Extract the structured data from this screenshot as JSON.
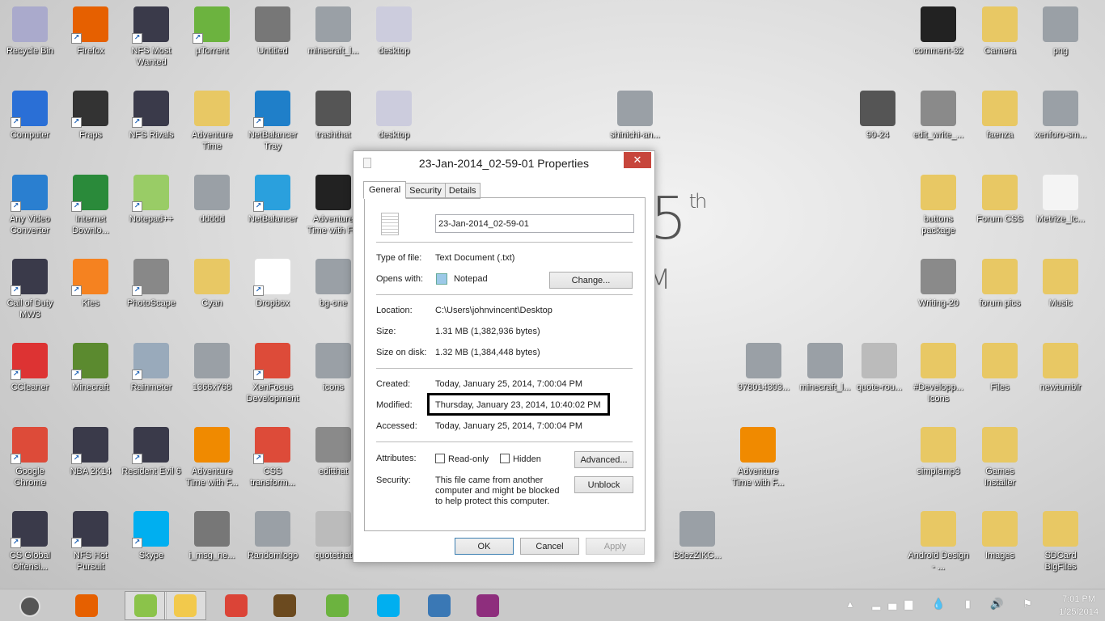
{
  "wallpaper": {
    "clock_day": "25",
    "clock_suffix": "th",
    "clock_fragment": "M"
  },
  "desktop_icons": [
    {
      "label": "Recycle Bin",
      "icon": "recycle-bin-icon",
      "short": false
    },
    {
      "label": "Firefox",
      "icon": "firefox-icon",
      "short": true
    },
    {
      "label": "NFS Most Wanted",
      "icon": "game-icon",
      "short": true
    },
    {
      "label": "µTorrent",
      "icon": "utorrent-icon",
      "short": true
    },
    {
      "label": "Untitled",
      "icon": "gimp-icon",
      "short": false
    },
    {
      "label": "minecraft_l...",
      "icon": "image-icon",
      "short": false
    },
    {
      "label": "desktop",
      "icon": "settings-file-icon",
      "short": false
    },
    {
      "label": "Computer",
      "icon": "computer-icon",
      "short": true
    },
    {
      "label": "Fraps",
      "icon": "fraps-icon",
      "short": true
    },
    {
      "label": "NFS Rivals",
      "icon": "game-icon",
      "short": true
    },
    {
      "label": "Adventure Time",
      "icon": "folder-icon",
      "short": false
    },
    {
      "label": "NetBalancer Tray",
      "icon": "netbalancer-icon",
      "short": true
    },
    {
      "label": "trashthat",
      "icon": "trash-icon",
      "short": false
    },
    {
      "label": "desktop",
      "icon": "settings-file-icon",
      "short": false
    },
    {
      "label": "Any Video Converter",
      "icon": "video-converter-icon",
      "short": true
    },
    {
      "label": "Internet Downlo...",
      "icon": "download-manager-icon",
      "short": true
    },
    {
      "label": "Notepad++",
      "icon": "notepadpp-icon",
      "short": true
    },
    {
      "label": "ddddd",
      "icon": "image-icon",
      "short": false
    },
    {
      "label": "NetBalancer",
      "icon": "globe-icon",
      "short": true
    },
    {
      "label": "Adventure Time with F...",
      "icon": "video-icon",
      "short": false
    },
    {
      "label": "Call of Duty MW3",
      "icon": "game-icon",
      "short": true
    },
    {
      "label": "Kies",
      "icon": "kies-icon",
      "short": true
    },
    {
      "label": "PhotoScape",
      "icon": "photoscape-icon",
      "short": true
    },
    {
      "label": "Cyan",
      "icon": "folder-icon",
      "short": false
    },
    {
      "label": "Dropbox",
      "icon": "dropbox-icon",
      "short": true
    },
    {
      "label": "bg-one",
      "icon": "image-icon",
      "short": false
    },
    {
      "label": "CCleaner",
      "icon": "ccleaner-icon",
      "short": true
    },
    {
      "label": "Minecraft",
      "icon": "minecraft-icon",
      "short": true
    },
    {
      "label": "Rainmeter",
      "icon": "rainmeter-icon",
      "short": true
    },
    {
      "label": "1366x768",
      "icon": "image-icon",
      "short": false
    },
    {
      "label": "XenFocus Development",
      "icon": "chrome-icon",
      "short": true
    },
    {
      "label": "icons",
      "icon": "image-icon",
      "short": false
    },
    {
      "label": "Google Chrome",
      "icon": "chrome-icon",
      "short": true
    },
    {
      "label": "NBA 2K14",
      "icon": "game-icon",
      "short": true
    },
    {
      "label": "Resident Evil 6",
      "icon": "game-icon",
      "short": true
    },
    {
      "label": "Adventure Time with F...",
      "icon": "vlc-icon",
      "short": false
    },
    {
      "label": "CSS transform...",
      "icon": "chrome-icon",
      "short": true
    },
    {
      "label": "editthat",
      "icon": "edit-icon",
      "short": false
    },
    {
      "label": "CS Global Offensi...",
      "icon": "game-icon",
      "short": true
    },
    {
      "label": "NFS Hot Pursuit",
      "icon": "game-icon",
      "short": true
    },
    {
      "label": "Skype",
      "icon": "skype-icon",
      "short": true
    },
    {
      "label": "i_msg_ne...",
      "icon": "gimp-icon",
      "short": false
    },
    {
      "label": "Randomlogo",
      "icon": "image-icon",
      "short": false
    },
    {
      "label": "quotethat",
      "icon": "quote-icon",
      "short": false
    },
    {
      "label": "shinichi-an...",
      "icon": "image-icon",
      "short": false
    },
    {
      "label": "90-24",
      "icon": "trash-icon",
      "short": false
    },
    {
      "label": "978014303...",
      "icon": "image-icon",
      "short": false
    },
    {
      "label": "minecraft_l...",
      "icon": "image-icon",
      "short": false
    },
    {
      "label": "quote-rou...",
      "icon": "quote-icon",
      "short": false
    },
    {
      "label": "Adventure Time with F...",
      "icon": "vlc-icon",
      "short": false
    },
    {
      "label": "BdezZIKC...",
      "icon": "image-icon",
      "short": false
    },
    {
      "label": "comment-32",
      "icon": "comment-icon",
      "short": false
    },
    {
      "label": "Camera",
      "icon": "folder-icon",
      "short": false
    },
    {
      "label": "png",
      "icon": "image-icon",
      "short": false
    },
    {
      "label": "edit_write_...",
      "icon": "edit-icon",
      "short": false
    },
    {
      "label": "faenza",
      "icon": "folder-icon",
      "short": false
    },
    {
      "label": "xenforo-sm...",
      "icon": "image-icon",
      "short": false
    },
    {
      "label": "buttons package",
      "icon": "folder-icon",
      "short": false
    },
    {
      "label": "Forum CSS",
      "icon": "folder-icon",
      "short": false
    },
    {
      "label": "Metrize_Ic...",
      "icon": "document-icon",
      "short": false
    },
    {
      "label": "Writing-20",
      "icon": "edit-icon",
      "short": false
    },
    {
      "label": "forum pics",
      "icon": "folder-icon",
      "short": false
    },
    {
      "label": "Music",
      "icon": "folder-icon",
      "short": false
    },
    {
      "label": "#Developp... Icons",
      "icon": "folder-icon",
      "short": false
    },
    {
      "label": "Files",
      "icon": "folder-icon",
      "short": false
    },
    {
      "label": "newtumblr",
      "icon": "folder-icon",
      "short": false
    },
    {
      "label": "simplemp3",
      "icon": "folder-icon",
      "short": false
    },
    {
      "label": "Games Installer",
      "icon": "folder-icon",
      "short": false
    },
    {
      "label": "Android Design - ...",
      "icon": "folder-icon",
      "short": false
    },
    {
      "label": "Images",
      "icon": "folder-icon",
      "short": false
    },
    {
      "label": "SDCard BigFiles",
      "icon": "folder-icon",
      "short": false
    }
  ],
  "dialog": {
    "title": "23-Jan-2014_02-59-01 Properties",
    "close": "✕",
    "tabs": [
      "General",
      "Security",
      "Details"
    ],
    "filename": "23-Jan-2014_02-59-01",
    "type_label": "Type of file:",
    "type_value": "Text Document (.txt)",
    "opens_label": "Opens with:",
    "opens_value": "Notepad",
    "change_button": "Change...",
    "location_label": "Location:",
    "location_value": "C:\\Users\\johnvincent\\Desktop",
    "size_label": "Size:",
    "size_value": "1.31 MB (1,382,936 bytes)",
    "disk_label": "Size on disk:",
    "disk_value": "1.32 MB (1,384,448 bytes)",
    "created_label": "Created:",
    "created_value": "Today, January 25, 2014, 7:00:04 PM",
    "modified_label": "Modified:",
    "modified_value": "Thursday, January 23, 2014, 10:40:02 PM",
    "accessed_label": "Accessed:",
    "accessed_value": "Today, January 25, 2014, 7:00:04 PM",
    "attributes_label": "Attributes:",
    "readonly_label": "Read-only",
    "readonly_checked": false,
    "hidden_label": "Hidden",
    "hidden_checked": false,
    "advanced_button": "Advanced...",
    "security_label": "Security:",
    "security_text": "This file came from another computer and might be blocked to help protect this computer.",
    "unblock_button": "Unblock",
    "ok": "OK",
    "cancel": "Cancel",
    "apply": "Apply"
  },
  "taskbar": {
    "apps": [
      {
        "name": "firefox-icon",
        "color": "#e66000"
      },
      {
        "name": "notepadpp-icon",
        "color": "#8bc34a"
      },
      {
        "name": "file-explorer-icon",
        "color": "#f2c94c"
      },
      {
        "name": "chrome-icon",
        "color": "#db4437"
      },
      {
        "name": "counter-strike-icon",
        "color": "#6b4a1f"
      },
      {
        "name": "utorrent-icon",
        "color": "#6cb33f"
      },
      {
        "name": "skype-icon",
        "color": "#00aff0"
      },
      {
        "name": "photo-viewer-icon",
        "color": "#3a78b5"
      },
      {
        "name": "winrar-icon",
        "color": "#8e2e7d"
      }
    ],
    "tray_icons": "▴ ▂▄▆ 💧 ▮ 🔊 ⚑",
    "time": "7:01 PM",
    "date": "1/25/2014"
  }
}
